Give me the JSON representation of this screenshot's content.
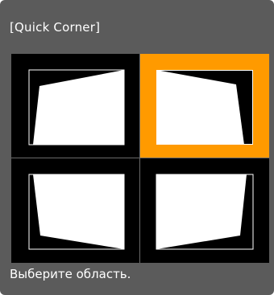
{
  "dialog": {
    "title": "[Quick Corner]",
    "status_text": "Выберите область.",
    "selected_area": "top-right",
    "colors": {
      "background": "#5b5b5b",
      "highlight": "#ff9a00",
      "screen": "#ffffff",
      "grid": "#000000"
    },
    "areas": [
      {
        "id": "top-left",
        "icon": "top-left-corner-icon"
      },
      {
        "id": "top-right",
        "icon": "top-right-corner-icon"
      },
      {
        "id": "bottom-left",
        "icon": "bottom-left-corner-icon"
      },
      {
        "id": "bottom-right",
        "icon": "bottom-right-corner-icon"
      }
    ]
  }
}
